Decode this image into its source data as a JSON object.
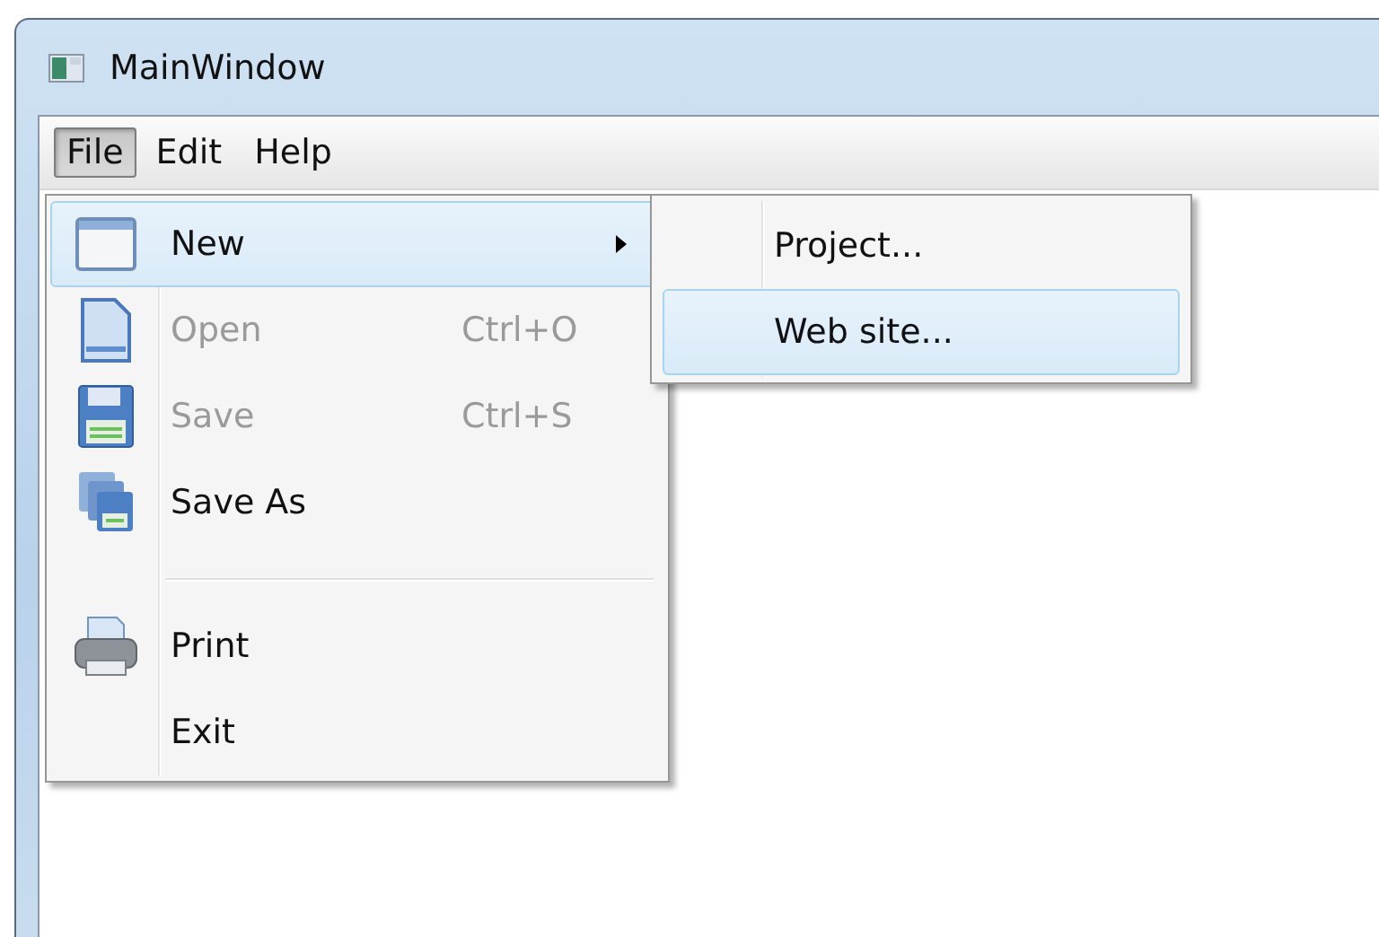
{
  "window": {
    "title": "MainWindow"
  },
  "menu_bar": [
    {
      "label": "File",
      "selected": true
    },
    {
      "label": "Edit",
      "selected": false
    },
    {
      "label": "Help",
      "selected": false
    }
  ],
  "file_menu": [
    {
      "kind": "item",
      "label": "New",
      "disabled": false,
      "selected": true,
      "has_submenu": true
    },
    {
      "kind": "item",
      "label": "Open",
      "shortcut": "Ctrl+O",
      "disabled": true,
      "selected": false,
      "has_submenu": false
    },
    {
      "kind": "item",
      "label": "Save",
      "shortcut": "Ctrl+S",
      "disabled": true,
      "selected": false,
      "has_submenu": false
    },
    {
      "kind": "item",
      "label": "Save As",
      "disabled": false,
      "selected": false,
      "has_submenu": false
    },
    {
      "kind": "separator"
    },
    {
      "kind": "item",
      "label": "Print",
      "disabled": false,
      "selected": false,
      "has_submenu": false
    },
    {
      "kind": "item",
      "label": "Exit",
      "disabled": false,
      "selected": false,
      "has_submenu": false
    }
  ],
  "new_submenu": [
    {
      "label": "Project...",
      "selected": false
    },
    {
      "label": "Web site...",
      "selected": true
    }
  ]
}
